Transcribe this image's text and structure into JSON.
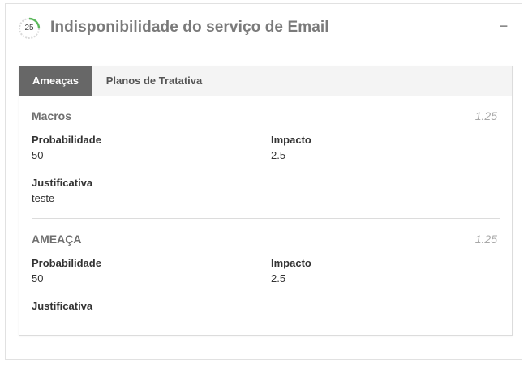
{
  "header": {
    "gauge_value": "25",
    "gauge_level": 0.25,
    "title": "Indisponibilidade do serviço de Email",
    "collapse_icon": "minus-icon",
    "collapse_glyph": "−"
  },
  "tabs": [
    {
      "label": "Ameaças",
      "active": true
    },
    {
      "label": "Planos de Tratativa",
      "active": false
    }
  ],
  "threats": [
    {
      "name": "Macros",
      "score": "1.25",
      "probability_label": "Probabilidade",
      "probability": "50",
      "impact_label": "Impacto",
      "impact": "2.5",
      "justification_label": "Justificativa",
      "justification": "teste"
    },
    {
      "name": "AMEAÇA",
      "score": "1.25",
      "probability_label": "Probabilidade",
      "probability": "50",
      "impact_label": "Impacto",
      "impact": "2.5",
      "justification_label": "Justificativa",
      "justification": ""
    }
  ],
  "colors": {
    "gauge_track": "#d9d9d9",
    "gauge_fill": "#5cb85c",
    "active_tab_bg": "#676767"
  }
}
